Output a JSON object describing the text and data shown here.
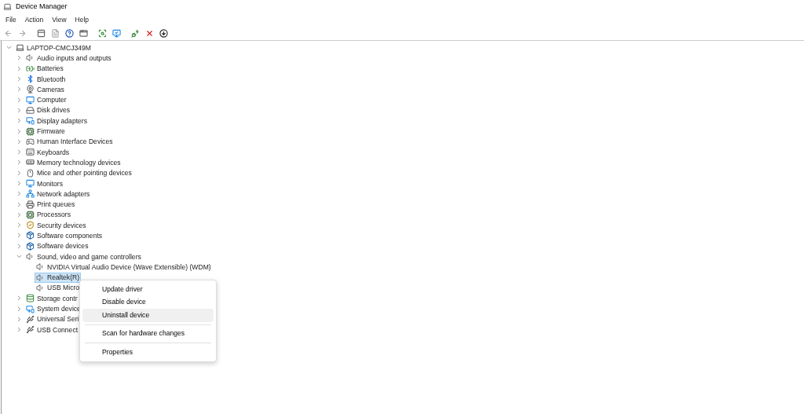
{
  "window": {
    "title": "Device Manager"
  },
  "menu_bar": [
    "File",
    "Action",
    "View",
    "Help"
  ],
  "toolbar": [
    {
      "kind": "back",
      "disabled": true
    },
    {
      "kind": "forward",
      "disabled": true
    },
    {
      "kind": "panel",
      "disabled": false
    },
    {
      "kind": "page",
      "disabled": true
    },
    {
      "kind": "help",
      "disabled": false
    },
    {
      "kind": "window",
      "disabled": false
    },
    {
      "kind": "scan",
      "disabled": false
    },
    {
      "kind": "monitor",
      "disabled": false
    },
    {
      "kind": "add",
      "disabled": false
    },
    {
      "kind": "remove",
      "disabled": false
    },
    {
      "kind": "download",
      "disabled": false
    }
  ],
  "tree": {
    "label": "LAPTOP-CMCJ349M",
    "kind": "computer",
    "expanded": true,
    "selected": false,
    "children": [
      {
        "label": "Audio inputs and outputs",
        "kind": "speaker",
        "expanded": false,
        "selected": false
      },
      {
        "label": "Batteries",
        "kind": "battery",
        "expanded": false,
        "selected": false
      },
      {
        "label": "Bluetooth",
        "kind": "bluetooth",
        "expanded": false,
        "selected": false
      },
      {
        "label": "Cameras",
        "kind": "camera",
        "expanded": false,
        "selected": false
      },
      {
        "label": "Computer",
        "kind": "monitor",
        "expanded": false,
        "selected": false
      },
      {
        "label": "Disk drives",
        "kind": "disk",
        "expanded": false,
        "selected": false
      },
      {
        "label": "Display adapters",
        "kind": "display",
        "expanded": false,
        "selected": false
      },
      {
        "label": "Firmware",
        "kind": "chip",
        "expanded": false,
        "selected": false
      },
      {
        "label": "Human Interface Devices",
        "kind": "hid",
        "expanded": false,
        "selected": false
      },
      {
        "label": "Keyboards",
        "kind": "keyboard",
        "expanded": false,
        "selected": false
      },
      {
        "label": "Memory technology devices",
        "kind": "memory",
        "expanded": false,
        "selected": false
      },
      {
        "label": "Mice and other pointing devices",
        "kind": "mouse",
        "expanded": false,
        "selected": false
      },
      {
        "label": "Monitors",
        "kind": "monitor",
        "expanded": false,
        "selected": false
      },
      {
        "label": "Network adapters",
        "kind": "network",
        "expanded": false,
        "selected": false
      },
      {
        "label": "Print queues",
        "kind": "printer",
        "expanded": false,
        "selected": false
      },
      {
        "label": "Processors",
        "kind": "chip",
        "expanded": false,
        "selected": false
      },
      {
        "label": "Security devices",
        "kind": "security",
        "expanded": false,
        "selected": false
      },
      {
        "label": "Software components",
        "kind": "software",
        "expanded": false,
        "selected": false
      },
      {
        "label": "Software devices",
        "kind": "software",
        "expanded": false,
        "selected": false
      },
      {
        "label": "Sound, video and game controllers",
        "kind": "speaker",
        "expanded": true,
        "selected": false,
        "children": [
          {
            "label": "NVIDIA Virtual Audio Device (Wave Extensible) (WDM)",
            "kind": "speaker",
            "selected": false
          },
          {
            "label": "Realtek(R)",
            "kind": "speaker",
            "selected": true
          },
          {
            "label": "USB Micro",
            "kind": "speaker",
            "selected": false
          }
        ]
      },
      {
        "label": "Storage contr",
        "kind": "storage",
        "expanded": false,
        "selected": false
      },
      {
        "label": "System device",
        "kind": "display",
        "expanded": false,
        "selected": false
      },
      {
        "label": "Universal Seri",
        "kind": "usb",
        "expanded": false,
        "selected": false
      },
      {
        "label": "USB Connect",
        "kind": "usb",
        "expanded": false,
        "selected": false
      }
    ]
  },
  "context_menu": [
    {
      "kind": "item",
      "label": "Update driver",
      "highlighted": false
    },
    {
      "kind": "item",
      "label": "Disable device",
      "highlighted": false
    },
    {
      "kind": "item",
      "label": "Uninstall device",
      "highlighted": true
    },
    {
      "kind": "separator"
    },
    {
      "kind": "item",
      "label": "Scan for hardware changes",
      "highlighted": false
    },
    {
      "kind": "separator"
    },
    {
      "kind": "item",
      "label": "Properties",
      "highlighted": false
    }
  ]
}
